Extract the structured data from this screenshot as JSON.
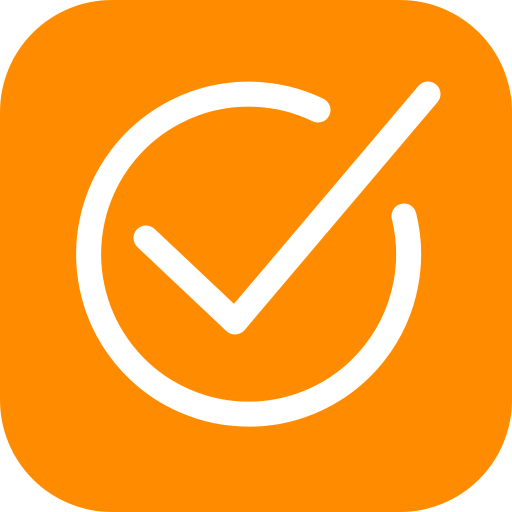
{
  "icon": {
    "name": "checkmark-circle-app-icon",
    "background_color": "#FF8C00",
    "glyph_color": "#FFFFFF",
    "glyph": "check-circle-icon"
  }
}
